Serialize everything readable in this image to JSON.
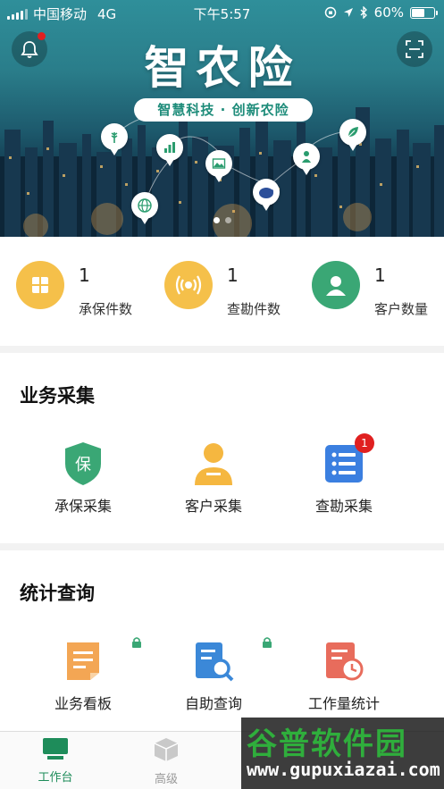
{
  "status_bar": {
    "carrier": "中国移动",
    "network": "4G",
    "time": "下午5:57",
    "battery": "60%",
    "battery_level": 0.6
  },
  "banner": {
    "title": "智农险",
    "subtitle": "智慧科技 · 创新农险",
    "notification_dot": true,
    "active_slide": 1,
    "slide_count": 2
  },
  "stats": [
    {
      "value": "1",
      "label": "承保件数",
      "icon": "document-icon",
      "color": "#f5c04a"
    },
    {
      "value": "1",
      "label": "查勘件数",
      "icon": "signal-icon",
      "color": "#f5c04a"
    },
    {
      "value": "1",
      "label": "客户数量",
      "icon": "user-icon",
      "color": "#3aa775"
    }
  ],
  "business": {
    "title": "业务采集",
    "items": [
      {
        "label": "承保采集",
        "icon": "shield-icon",
        "color": "#3aa775",
        "glyph": "保"
      },
      {
        "label": "客户采集",
        "icon": "person-icon",
        "color": "#f5b740"
      },
      {
        "label": "查勘采集",
        "icon": "list-icon",
        "color": "#3b7fe0",
        "badge": "1"
      }
    ]
  },
  "query": {
    "title": "统计查询",
    "items": [
      {
        "label": "业务看板",
        "icon": "board-icon",
        "color": "#f3a654",
        "locked": true
      },
      {
        "label": "自助查询",
        "icon": "search-doc-icon",
        "color": "#3b88d8",
        "locked": true
      },
      {
        "label": "工作量统计",
        "icon": "clock-doc-icon",
        "color": "#e86c5c",
        "locked": false
      }
    ]
  },
  "tabbar": {
    "tabs": [
      {
        "label": "工作台",
        "icon": "monitor-icon",
        "active": true
      },
      {
        "label": "高级",
        "icon": "cube-icon",
        "active": false
      }
    ],
    "active_color": "#1e8c5a"
  },
  "watermark": {
    "title": "谷普软件园",
    "url": "www.gupuxiazai.com"
  }
}
